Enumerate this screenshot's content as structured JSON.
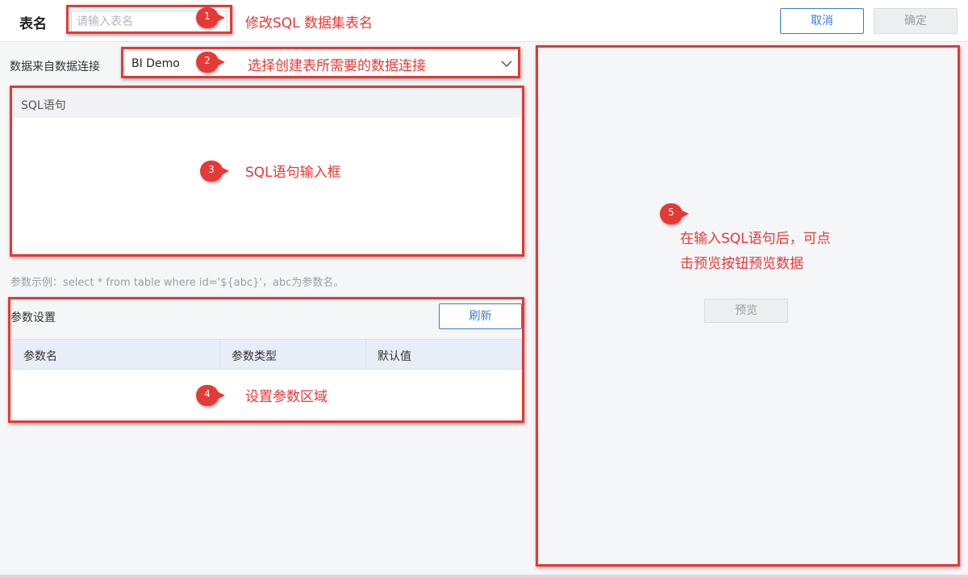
{
  "topbar": {
    "table_name_label": "表名",
    "table_name_placeholder": "请输入表名",
    "cancel_label": "取消",
    "confirm_label": "确定"
  },
  "source": {
    "label": "数据来自数据连接",
    "selected": "BI Demo",
    "chevron_icon": "chevron-down-icon"
  },
  "sql": {
    "header": "SQL语句",
    "value": ""
  },
  "param_hint": "参数示例：select * from table where id='${abc}'，abc为参数名。",
  "params": {
    "title": "参数设置",
    "refresh_label": "刷新",
    "columns": [
      "参数名",
      "参数类型",
      "默认值"
    ]
  },
  "preview": {
    "button_label": "预览"
  },
  "annotations": {
    "color": "#e53935",
    "items": [
      {
        "num": "1",
        "text": "修改SQL 数据集表名"
      },
      {
        "num": "2",
        "text": "选择创建表所需要的数据连接"
      },
      {
        "num": "3",
        "text": "SQL语句输入框"
      },
      {
        "num": "4",
        "text": "设置参数区域"
      },
      {
        "num": "5",
        "line1": "在输入SQL语句后，可点",
        "line2": "击预览按钮预览数据"
      }
    ]
  },
  "colors": {
    "accent": "#3a7bd5",
    "disabled": "#9a9da2",
    "background": "#f5f6f8"
  }
}
